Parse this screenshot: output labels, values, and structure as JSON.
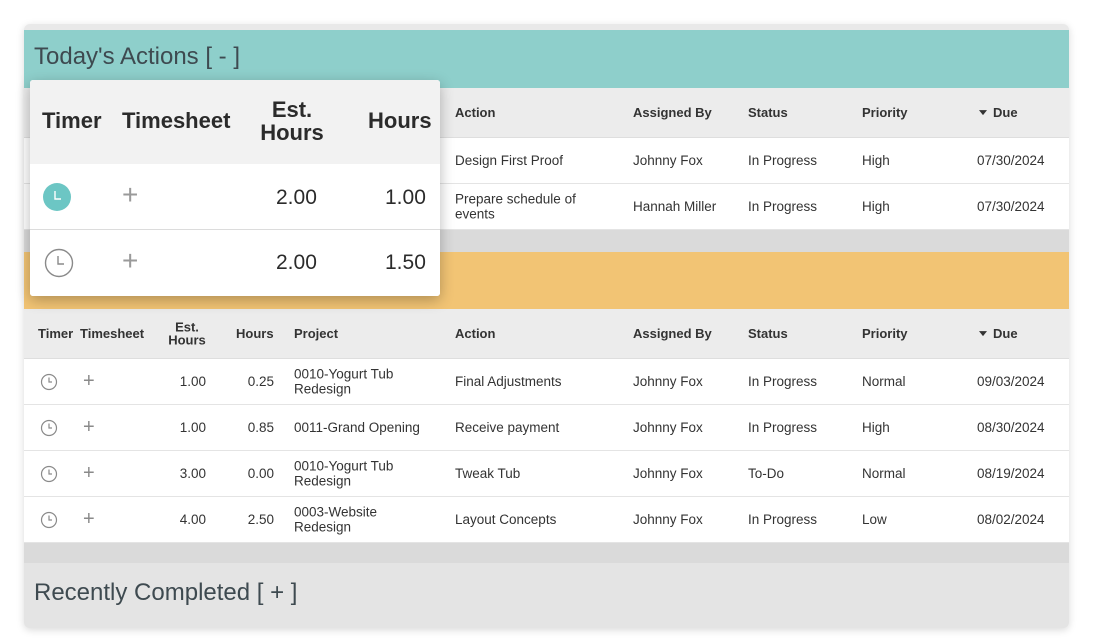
{
  "todays_actions": {
    "title": "Today's Actions [ - ]",
    "columns": {
      "timer": "Timer",
      "timesheet": "Timesheet",
      "est_hours": "Est. Hours",
      "hours": "Hours",
      "action": "Action",
      "assigned_by": "Assigned By",
      "status": "Status",
      "priority": "Priority",
      "due": "Due"
    },
    "rows": [
      {
        "timer_state": "active",
        "est_hours": "2.00",
        "hours": "1.00",
        "action": "Design First Proof",
        "assigned_by": "Johnny Fox",
        "status": "In Progress",
        "priority": "High",
        "due": "07/30/2024"
      },
      {
        "timer_state": "idle",
        "est_hours": "2.00",
        "hours": "1.50",
        "action": "Prepare schedule of events",
        "assigned_by": "Hannah Miller",
        "status": "In Progress",
        "priority": "High",
        "due": "07/30/2024"
      }
    ]
  },
  "upcoming": {
    "columns": {
      "timer": "Timer",
      "timesheet": "Timesheet",
      "est_hours": "Est. Hours",
      "hours": "Hours",
      "project": "Project",
      "action": "Action",
      "assigned_by": "Assigned By",
      "status": "Status",
      "priority": "Priority",
      "due": "Due"
    },
    "rows": [
      {
        "est_hours": "1.00",
        "hours": "0.25",
        "project": "0010-Yogurt Tub Redesign",
        "action": "Final Adjustments",
        "assigned_by": "Johnny Fox",
        "status": "In Progress",
        "priority": "Normal",
        "due": "09/03/2024"
      },
      {
        "est_hours": "1.00",
        "hours": "0.85",
        "project": "0011-Grand Opening",
        "action": "Receive payment",
        "assigned_by": "Johnny Fox",
        "status": "In Progress",
        "priority": "High",
        "due": "08/30/2024"
      },
      {
        "est_hours": "3.00",
        "hours": "0.00",
        "project": "0010-Yogurt Tub Redesign",
        "action": "Tweak Tub",
        "assigned_by": "Johnny Fox",
        "status": "To-Do",
        "priority": "Normal",
        "due": "08/19/2024"
      },
      {
        "est_hours": "4.00",
        "hours": "2.50",
        "project": "0003-Website Redesign",
        "action": "Layout Concepts",
        "assigned_by": "Johnny Fox",
        "status": "In Progress",
        "priority": "Low",
        "due": "08/02/2024"
      }
    ]
  },
  "recently_completed": {
    "title": "Recently Completed [ + ]"
  },
  "icons": {
    "timer": "clock-icon",
    "timesheet": "plus-icon",
    "sort": "sort-desc-icon"
  },
  "colors": {
    "teal_header": "#8ecfcb",
    "orange_band": "#f2c474",
    "timer_active": "#6cc6c4"
  }
}
